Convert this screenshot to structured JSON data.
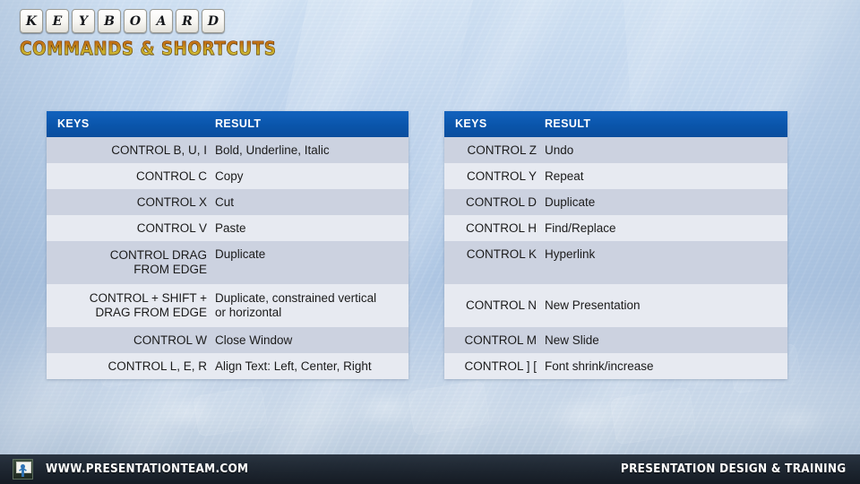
{
  "title": {
    "keys": [
      "K",
      "E",
      "Y",
      "B",
      "O",
      "A",
      "R",
      "D"
    ],
    "subtitle": "COMMANDS & SHORTCUTS"
  },
  "tables": {
    "left": {
      "headers": {
        "keys": "KEYS",
        "result": "RESULT"
      },
      "rows": [
        {
          "keys": "CONTROL B, U, I",
          "result": "Bold, Underline, Italic"
        },
        {
          "keys": "CONTROL C",
          "result": "Copy"
        },
        {
          "keys": "CONTROL X",
          "result": "Cut"
        },
        {
          "keys": "CONTROL V",
          "result": "Paste"
        },
        {
          "keys": "CONTROL DRAG\nFROM EDGE",
          "result": "Duplicate"
        },
        {
          "keys": "CONTROL + SHIFT +\nDRAG FROM EDGE",
          "result": "Duplicate, constrained vertical\nor horizontal"
        },
        {
          "keys": "CONTROL W",
          "result": "Close Window"
        },
        {
          "keys": "CONTROL L, E, R",
          "result": "Align Text: Left, Center, Right"
        }
      ]
    },
    "right": {
      "headers": {
        "keys": "KEYS",
        "result": "RESULT"
      },
      "rows": [
        {
          "keys": "CONTROL Z",
          "result": "Undo"
        },
        {
          "keys": "CONTROL Y",
          "result": "Repeat"
        },
        {
          "keys": "CONTROL D",
          "result": "Duplicate"
        },
        {
          "keys": "CONTROL H",
          "result": "Find/Replace"
        },
        {
          "keys": "CONTROL K",
          "result": "Hyperlink"
        },
        {
          "keys": "CONTROL N",
          "result": "New Presentation"
        },
        {
          "keys": "CONTROL M",
          "result": "New Slide"
        },
        {
          "keys": "CONTROL ] [",
          "result": "Font shrink/increase"
        }
      ]
    }
  },
  "footer": {
    "url": "WWW.PRESENTATIONTEAM.COM",
    "tagline": "PRESENTATION DESIGN & TRAINING"
  },
  "colors": {
    "header_blue": "#0a55ab",
    "row_odd": "#ccd2e0",
    "row_even": "#e7eaf1",
    "footer_bar": "#161e28",
    "accent_orange": "#f2971d"
  }
}
